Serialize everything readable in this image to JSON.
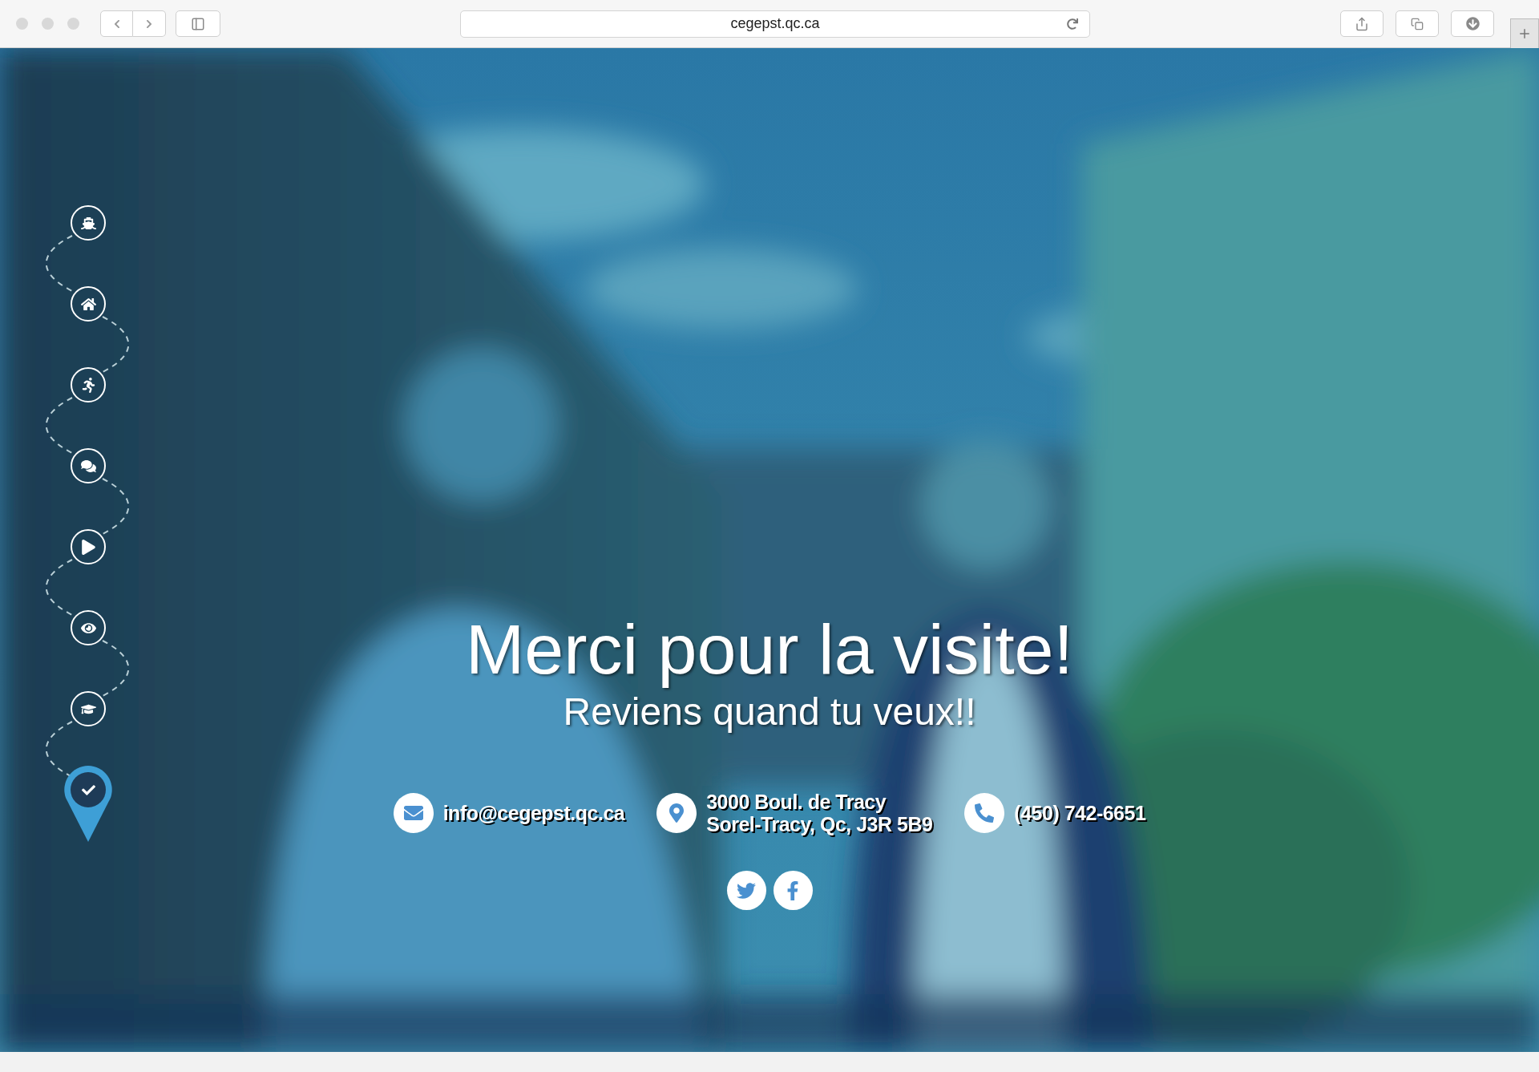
{
  "browser": {
    "url": "cegepst.qc.ca"
  },
  "nav": {
    "steps": [
      {
        "selected": false
      },
      {
        "selected": false
      },
      {
        "selected": false
      },
      {
        "selected": false
      },
      {
        "selected": false
      },
      {
        "selected": false
      },
      {
        "selected": false
      },
      {
        "selected": true
      }
    ]
  },
  "hero": {
    "title": "Merci pour la visite!",
    "subtitle": "Reviens quand tu veux!!"
  },
  "contacts": [
    {
      "kind": "email",
      "lines": [
        "info@cegepst.qc.ca"
      ]
    },
    {
      "kind": "address",
      "lines": [
        "3000 Boul. de Tracy",
        "Sorel-Tracy, Qc, J3R 5B9"
      ]
    },
    {
      "kind": "phone",
      "lines": [
        "(450) 742-6651"
      ]
    }
  ],
  "social": [
    {
      "kind": "twitter"
    },
    {
      "kind": "facebook"
    }
  ]
}
